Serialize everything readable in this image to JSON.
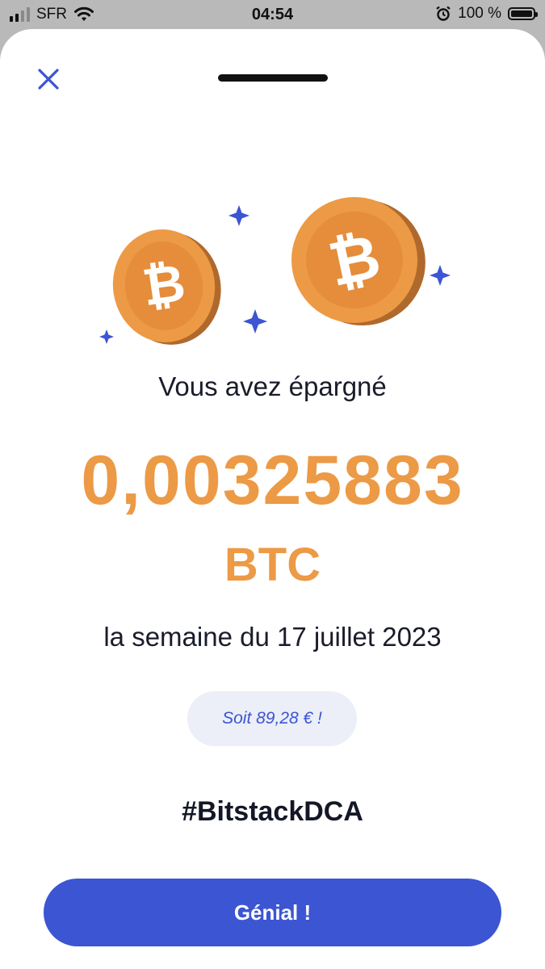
{
  "colors": {
    "accent": "#3b55d3",
    "bitcoin_orange": "#ec9a45",
    "pill_text": "#3b55d3",
    "pill_bg": "#eceef8"
  },
  "status_bar": {
    "carrier": "SFR",
    "time": "04:54",
    "battery": "100 %",
    "battery_level": 1.0,
    "icons": [
      "signal-icon",
      "wifi-icon",
      "alarm-icon",
      "battery-icon"
    ]
  },
  "sheet": {
    "close_icon": "close-icon",
    "headline": "Vous avez épargné",
    "amount": "0,00325883",
    "currency": "BTC",
    "period": "la semaine du 17 juillet 2023",
    "fiat_equivalent": "Soit 89,28 € !",
    "hashtag": "#BitstackDCA",
    "cta_label": "Génial !"
  }
}
